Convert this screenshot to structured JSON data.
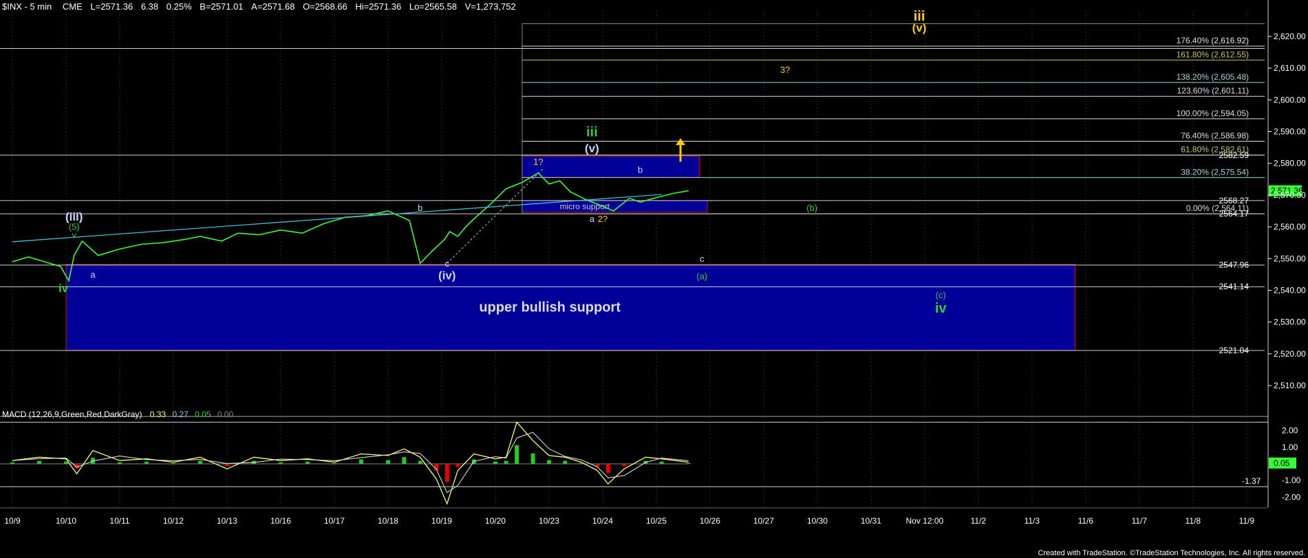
{
  "header": {
    "symbol": "$INX - 5 min",
    "exchange": "CME",
    "last": "L=2571.36",
    "change": "6.38",
    "change_pct": "0.25%",
    "bid": "B=2571.01",
    "ask": "A=2571.68",
    "open": "O=2568.66",
    "high": "Hi=2571.36",
    "low": "Lo=2565.58",
    "volume": "V=1,273,752"
  },
  "footer": {
    "credit": "Created with TradeStation. ©TradeStation Technologies, Inc. All rights reserved."
  },
  "colors": {
    "price": "#33ff33",
    "support_box": "#000099",
    "box_border": "#cc1111",
    "axis": "#ffffff",
    "trendline": "#3fc0d8",
    "macd_line": "#ffff66",
    "signal_line": "#d8d8d8",
    "hist_pos": "#22cc22",
    "hist_neg": "#ee0000",
    "wave_green": "#33cc33",
    "wave_yellow": "#ffcc00",
    "wave_white": "#c8d8ff"
  },
  "chart_data": {
    "type": "line",
    "instrument": "$INX",
    "interval": "5 min",
    "ylim": [
      2502,
      2628
    ],
    "y_ticks": [
      "2,510.00",
      "2,520.00",
      "2,530.00",
      "2,540.00",
      "2,550.00",
      "2,560.00",
      "2,570.00",
      "2,580.00",
      "2,590.00",
      "2,600.00",
      "2,610.00",
      "2,620.00"
    ],
    "x_ticks": [
      "10/9",
      "10/10",
      "10/11",
      "10/12",
      "10/13",
      "10/16",
      "10/17",
      "10/18",
      "10/19",
      "10/20",
      "10/23",
      "10/24",
      "10/25",
      "10/26",
      "10/27",
      "10/30",
      "10/31",
      "Nov 12:00",
      "11/2",
      "11/3",
      "11/6",
      "11/7",
      "11/8",
      "11/9"
    ],
    "x_range": [
      0,
      23.4
    ],
    "price_series": {
      "name": "$INX",
      "x": [
        0,
        0.3,
        0.6,
        0.9,
        1.05,
        1.15,
        1.3,
        1.6,
        2,
        2.4,
        2.8,
        3.2,
        3.5,
        3.9,
        4.2,
        4.6,
        5,
        5.4,
        5.8,
        6.2,
        6.6,
        7,
        7.4,
        7.6,
        7.8,
        8.05,
        8.15,
        8.3,
        8.45,
        8.6,
        8.9,
        9.2,
        9.5,
        9.8,
        10,
        10.2,
        10.4,
        10.7,
        11,
        11.2,
        11.5,
        11.7,
        11.85,
        12,
        12.3,
        12.6
      ],
      "y": [
        2549,
        2550.5,
        2549,
        2547.5,
        2543,
        2551,
        2555.5,
        2551,
        2553,
        2554.5,
        2555,
        2556,
        2557,
        2555.5,
        2558,
        2557.5,
        2559,
        2558,
        2561,
        2563,
        2563.5,
        2565,
        2562,
        2548.5,
        2552,
        2556,
        2558.5,
        2557,
        2560,
        2562.5,
        2567,
        2572,
        2574,
        2577,
        2573.5,
        2574.5,
        2571,
        2568.5,
        2566.5,
        2565,
        2569,
        2567.8,
        2568.5,
        2569.2,
        2570.5,
        2571.36
      ]
    },
    "horizontal_levels": [
      2541.14,
      2547.96,
      2521.04,
      2564.11,
      2568.27
    ],
    "price_labels": [
      "2568.27",
      "2564.17",
      "2582.59",
      "2547.96",
      "2541.14",
      "2521.04",
      "2,571.36"
    ],
    "fibonacci": {
      "levels": [
        {
          "label": "176.40% (2,616.92)",
          "value": 2616.92
        },
        {
          "label": "161.80% (2,612.55)",
          "value": 2612.55
        },
        {
          "label": "138.20% (2,605.48)",
          "value": 2605.48
        },
        {
          "label": "123.60% (2,601.11)",
          "value": 2601.11
        },
        {
          "label": "100.00% (2,594.05)",
          "value": 2594.05
        },
        {
          "label": "76.40% (2,586.98)",
          "value": 2586.98
        },
        {
          "label": "61.80% (2,582.61)",
          "value": 2582.61
        },
        {
          "label": "38.20% (2,575.54)",
          "value": 2575.54
        },
        {
          "label": "0.00% (2,564.11)",
          "value": 2564.11
        }
      ],
      "extra_label": "(2,616.92)"
    },
    "boxes": [
      {
        "name": "upper bullish support",
        "label": "upper bullish support",
        "x0": 1,
        "x1": 19.8,
        "y_top": 2548.2,
        "y_bottom": 2521.0
      },
      {
        "name": "resistance box",
        "label": "",
        "x0": 9.5,
        "x1": 12.8,
        "y_top": 2582.3,
        "y_bottom": 2575.6
      },
      {
        "name": "micro support",
        "label": "micro support",
        "x0": 9.5,
        "x1": 12.95,
        "y_top": 2568.3,
        "y_bottom": 2564.6
      }
    ],
    "trendline": {
      "x": [
        0,
        12.1
      ],
      "y": [
        2555.3,
        2570.2
      ]
    },
    "wave_labels": [
      {
        "text": "(iii)",
        "x": 1.15,
        "y": 2562,
        "color": "white"
      },
      {
        "text": "(5)",
        "x": 1.15,
        "y": 2559,
        "color": "green"
      },
      {
        "text": "v",
        "x": 1.15,
        "y": 2556.5,
        "color": "green"
      },
      {
        "text": "iv",
        "x": 0.95,
        "y": 2539.5,
        "color": "green"
      },
      {
        "text": "a",
        "x": 1.5,
        "y": 2544,
        "color": "white"
      },
      {
        "text": "b",
        "x": 7.6,
        "y": 2565,
        "color": "white"
      },
      {
        "text": "c",
        "x": 8.1,
        "y": 2547.5,
        "color": "white"
      },
      {
        "text": "(iv)",
        "x": 8.1,
        "y": 2543.5,
        "color": "white"
      },
      {
        "text": "1?",
        "x": 9.8,
        "y": 2579.5,
        "color": "yellow"
      },
      {
        "text": "iii",
        "x": 10.8,
        "y": 2588.5,
        "color": "green"
      },
      {
        "text": "(v)",
        "x": 10.8,
        "y": 2583.5,
        "color": "white"
      },
      {
        "text": "b",
        "x": 11.7,
        "y": 2577,
        "color": "white"
      },
      {
        "text": "a",
        "x": 10.8,
        "y": 2561.5,
        "color": "white"
      },
      {
        "text": "2?",
        "x": 11,
        "y": 2561.5,
        "color": "yellow"
      },
      {
        "text": "3?",
        "x": 14.4,
        "y": 2608.5,
        "color": "yellow"
      },
      {
        "text": "(b)",
        "x": 14.9,
        "y": 2565,
        "color": "green"
      },
      {
        "text": "c",
        "x": 12.85,
        "y": 2549,
        "color": "white"
      },
      {
        "text": "(a)",
        "x": 12.85,
        "y": 2543.5,
        "color": "green"
      },
      {
        "text": "(c)",
        "x": 17.3,
        "y": 2537.5,
        "color": "green"
      },
      {
        "text": "iv",
        "x": 17.3,
        "y": 2533,
        "color": "green"
      },
      {
        "text": "iii",
        "x": 16.9,
        "y": 2625,
        "color": "yellow"
      },
      {
        "text": "(v)",
        "x": 16.9,
        "y": 2621.5,
        "color": "yellow"
      }
    ],
    "arrow": {
      "x": 12.45,
      "y_from": 2580.5,
      "y_to": 2587.5,
      "color": "yellow",
      "direction": "up"
    },
    "macd": {
      "title": "MACD (12,26,9,Green,Red,DarkGray)",
      "values": [
        "0.33",
        "0.27",
        "0.05",
        "0.00"
      ],
      "ylim": [
        -2.6,
        2.6
      ],
      "y_ticks": [
        "2.00",
        "1.00",
        "-1.00",
        "-2.00"
      ],
      "reference_lines": [
        2.5,
        -1.37
      ],
      "reference_labels": [
        "-1.37"
      ],
      "current": "0.05",
      "macd_x": [
        0,
        0.5,
        1,
        1.2,
        1.5,
        2,
        2.5,
        3,
        3.5,
        4,
        4.5,
        5,
        5.5,
        6,
        6.5,
        7,
        7.3,
        7.6,
        7.9,
        8.1,
        8.3,
        8.6,
        9,
        9.2,
        9.4,
        9.7,
        10,
        10.3,
        10.6,
        10.9,
        11.1,
        11.4,
        11.8,
        12.1,
        12.6
      ],
      "macd_y": [
        0.2,
        0.4,
        0.3,
        -0.6,
        0.8,
        0.2,
        0.3,
        0.1,
        0.4,
        -0.3,
        0.4,
        0.2,
        0.3,
        0.1,
        0.6,
        0.5,
        0.9,
        0.4,
        -0.9,
        -2.4,
        -0.4,
        0.6,
        0.3,
        0.4,
        2.5,
        1.4,
        0.5,
        0.4,
        0.1,
        -0.4,
        -1.2,
        -0.3,
        0.4,
        0.3,
        0.1
      ]
    }
  }
}
